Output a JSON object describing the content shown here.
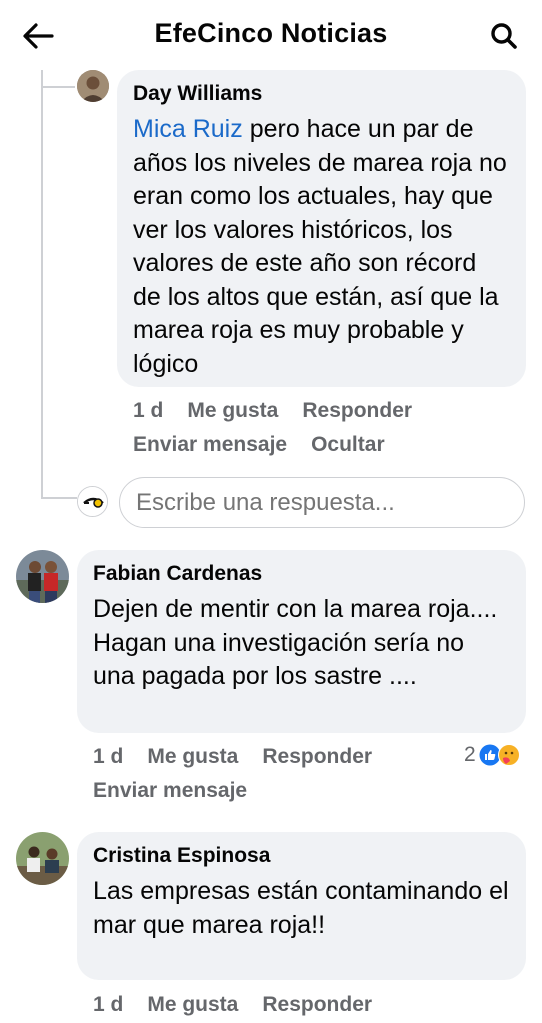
{
  "header": {
    "title": "EfeCinco Noticias",
    "back_icon": "arrow-left-icon",
    "search_icon": "search-icon"
  },
  "comments": [
    {
      "author": "Day Williams",
      "mention": "Mica Ruiz",
      "text": " pero hace un par de años los niveles de marea roja no eran como los actuales, hay que ver los valores históricos, los valores de este año son récord de los altos que están, así que la marea roja es muy probable y lógico",
      "time": "1 d",
      "like": "Me gusta",
      "reply": "Responder",
      "send_message": "Enviar mensaje",
      "hide": "Ocultar"
    },
    {
      "author": "Fabian Cardenas",
      "text": "Dejen de mentir con la marea roja.... Hagan una investigación sería no una pagada por los sastre ....",
      "time": "1 d",
      "like": "Me gusta",
      "reply": "Responder",
      "send_message": "Enviar mensaje",
      "reaction_count": "2"
    },
    {
      "author": "Cristina Espinosa",
      "text": "Las empresas están contaminando el mar que marea roja!!",
      "time": "1 d",
      "like": "Me gusta",
      "reply": "Responder"
    }
  ],
  "reply_box": {
    "placeholder": "Escribe una respuesta..."
  },
  "colors": {
    "link": "#1b6ac9",
    "bubble": "#f0f2f5",
    "muted": "#65676b",
    "like_blue": "#1877f2",
    "care_yellow": "#f7b125"
  }
}
